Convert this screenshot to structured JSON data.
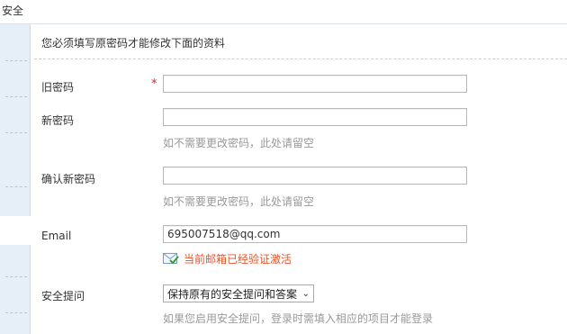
{
  "topbar": {
    "title": "安全"
  },
  "form": {
    "intro": "您必须填写原密码才能修改下面的资料",
    "old_password": {
      "label": "旧密码",
      "required_mark": "*",
      "value": ""
    },
    "new_password": {
      "label": "新密码",
      "value": "",
      "hint": "如不需要更改密码，此处请留空"
    },
    "confirm_password": {
      "label": "确认新密码",
      "value": "",
      "hint": "如不需要更改密码，此处请留空"
    },
    "email": {
      "label": "Email",
      "value": "695007518@qq.com",
      "verified_text": "当前邮箱已经验证激活",
      "verified_icon": "mail-check-icon"
    },
    "security_question": {
      "label": "安全提问",
      "selected": "保持原有的安全提问和答案",
      "hint": "如果您启用安全提问，登录时需填入相应的项目才能登录"
    }
  },
  "colors": {
    "sidebar_bg": "#e6eef7",
    "required": "#e02020",
    "verified": "#e8542a",
    "hint": "#999999"
  }
}
